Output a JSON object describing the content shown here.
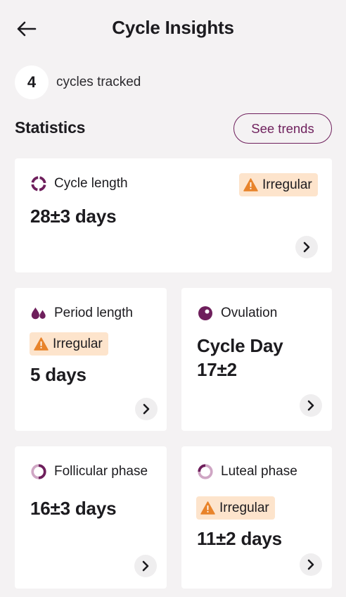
{
  "header": {
    "title": "Cycle Insights",
    "back_icon": "arrow-left-icon"
  },
  "tracked": {
    "count": "4",
    "label": "cycles tracked"
  },
  "statistics": {
    "title": "Statistics",
    "trends_button": "See trends"
  },
  "colors": {
    "accent": "#6e1f5c",
    "badge_bg": "#fde4cc",
    "warning": "#e8832a",
    "ring_light": "#cfa6c4"
  },
  "cards": {
    "cycle_length": {
      "label": "Cycle length",
      "value": "28±3 days",
      "badge": "Irregular",
      "icon": "ring-icon"
    },
    "period_length": {
      "label": "Period length",
      "value": "5 days",
      "badge": "Irregular",
      "icon": "drops-icon"
    },
    "ovulation": {
      "label": "Ovulation",
      "value_line1": "Cycle Day",
      "value_line2": "17±2",
      "icon": "ovulation-icon"
    },
    "follicular": {
      "label": "Follicular phase",
      "value": "16±3 days",
      "icon": "ring-icon"
    },
    "luteal": {
      "label": "Luteal phase",
      "value": "11±2 days",
      "badge": "Irregular",
      "icon": "ring-icon"
    }
  }
}
